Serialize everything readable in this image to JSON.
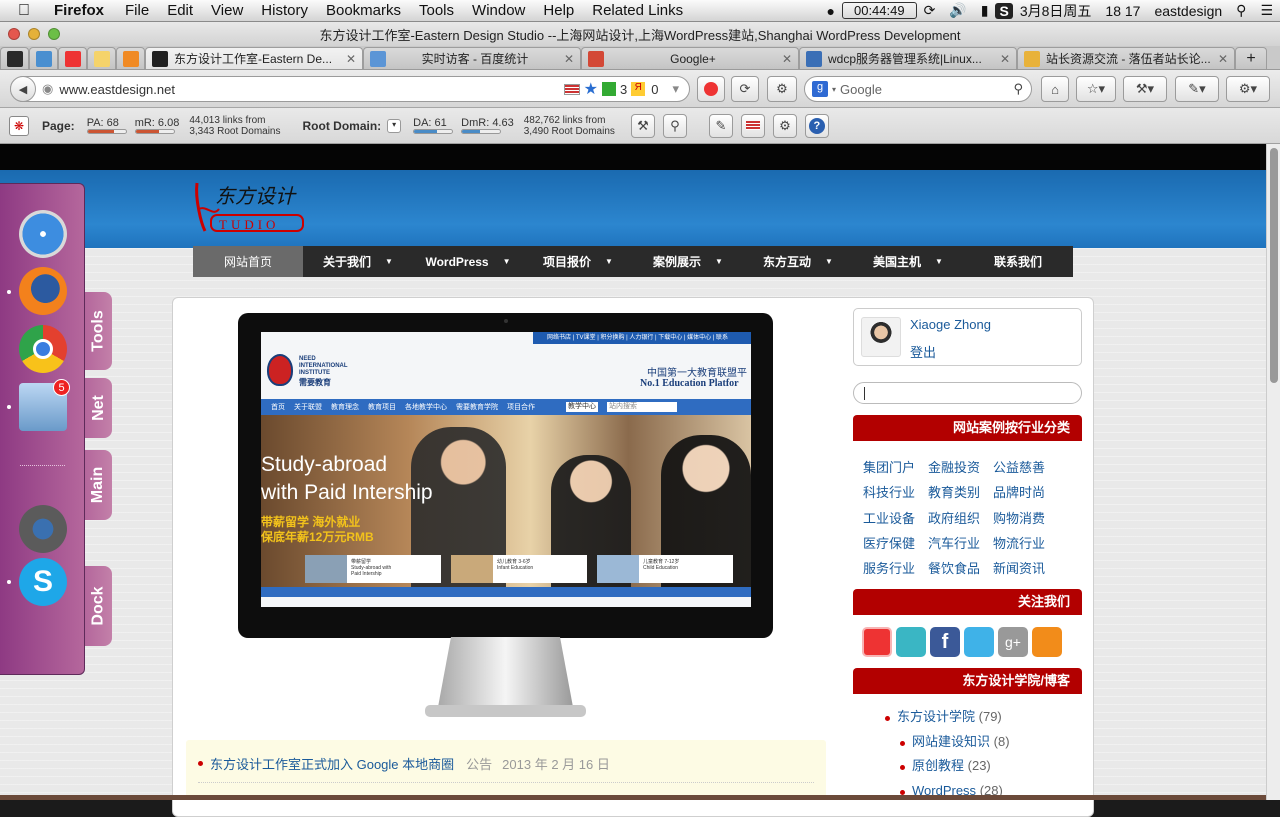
{
  "menubar": {
    "app": "Firefox",
    "items": [
      "File",
      "Edit",
      "View",
      "History",
      "Bookmarks",
      "Tools",
      "Window",
      "Help",
      "Related Links"
    ],
    "clock": "00:44:49",
    "date": "3月8日周五",
    "time": "18 17",
    "user": "eastdesign"
  },
  "window": {
    "title": "东方设计工作室-Eastern Design Studio --上海网站设计,上海WordPress建站,Shanghai WordPress Development"
  },
  "tabs": [
    {
      "label": "东方设计工作室-Eastern De...",
      "active": true
    },
    {
      "label": "实时访客 - 百度统计"
    },
    {
      "label": "Google+"
    },
    {
      "label": "wdcp服务器管理系统|Linux..."
    },
    {
      "label": "站长资源交流 - 落伍者站长论..."
    }
  ],
  "navbar": {
    "url": "www.eastdesign.net",
    "count_3": "3",
    "count_0": "0",
    "search_placeholder": "Google"
  },
  "mozbar": {
    "page_label": "Page:",
    "pa": "PA: 68",
    "pa_value": 68,
    "mr": "mR: 6.08",
    "mr_value": 6.08,
    "page_links": "44,013 links from",
    "page_roots": "3,343 Root Domains",
    "root_label": "Root Domain:",
    "da": "DA: 61",
    "da_value": 61,
    "dmr": "DmR: 4.63",
    "dmr_value": 4.63,
    "root_links": "482,762 links from",
    "root_roots": "3,490 Root Domains"
  },
  "site": {
    "menu": [
      "网站首页",
      "关于我们",
      "WordPress",
      "项目报价",
      "案例展示",
      "东方互动",
      "美国主机",
      "联系我们"
    ],
    "user_name": "Xiaoge Zhong",
    "logout": "登出",
    "cat_title": "网站案例按行业分类",
    "categories": [
      "集团门户",
      "金融投资",
      "公益慈善",
      "科技行业",
      "教育类别",
      "品牌时尚",
      "工业设备",
      "政府组织",
      "购物消费",
      "医疗保健",
      "汽车行业",
      "物流行业",
      "服务行业",
      "餐饮食品",
      "新闻资讯"
    ],
    "follow_title": "关注我们",
    "blog_title": "东方设计学院/博客",
    "blog": [
      {
        "name": "东方设计学院",
        "count": "(79)"
      },
      {
        "name": "网站建设知识",
        "count": "(8)"
      },
      {
        "name": "原创教程",
        "count": "(23)"
      },
      {
        "name": "WordPress",
        "count": "(28)"
      }
    ],
    "news": {
      "text": "东方设计工作室正式加入 Google 本地商圈",
      "tag": "公告",
      "date": "2013 年 2 月 16 日"
    }
  },
  "screenshot": {
    "org_en1": "NEED",
    "org_en2": "INTERNATIONAL",
    "org_en3": "INSTITUTE",
    "org_cn": "需要教育",
    "headline_cn": "中国第一大教育联盟平",
    "headline_en": "No.1 Education Platfor",
    "topnav": "网络书店 | TV课堂 | 积分换购 | 人力银行 | 下载中心 | 媒体中心 | 联系",
    "hero1": "Study-abroad",
    "hero2": "with Paid Intership",
    "hero_cn1": "带薪留学 海外就业",
    "hero_cn2": "保底年薪12万元RMB",
    "navrow": [
      "首页",
      "关于联盟",
      "教育理念",
      "教育项目",
      "各地教学中心",
      "需要教育学院",
      "项目合作"
    ],
    "search_label": "教学中心",
    "search_hint": "站内搜索",
    "thumb1": "带薪留学",
    "thumb1b": "Study-abroad with",
    "thumb1c": "Paid Intership",
    "thumb2": "幼儿教育 3-6岁",
    "thumb2b": "Infant Education",
    "thumb3": "儿童教育 7-12岁",
    "thumb3b": "Child Education"
  },
  "dock": {
    "tabs": [
      "Tools",
      "Net",
      "Main",
      "Dock"
    ],
    "mail_badge": "5"
  }
}
